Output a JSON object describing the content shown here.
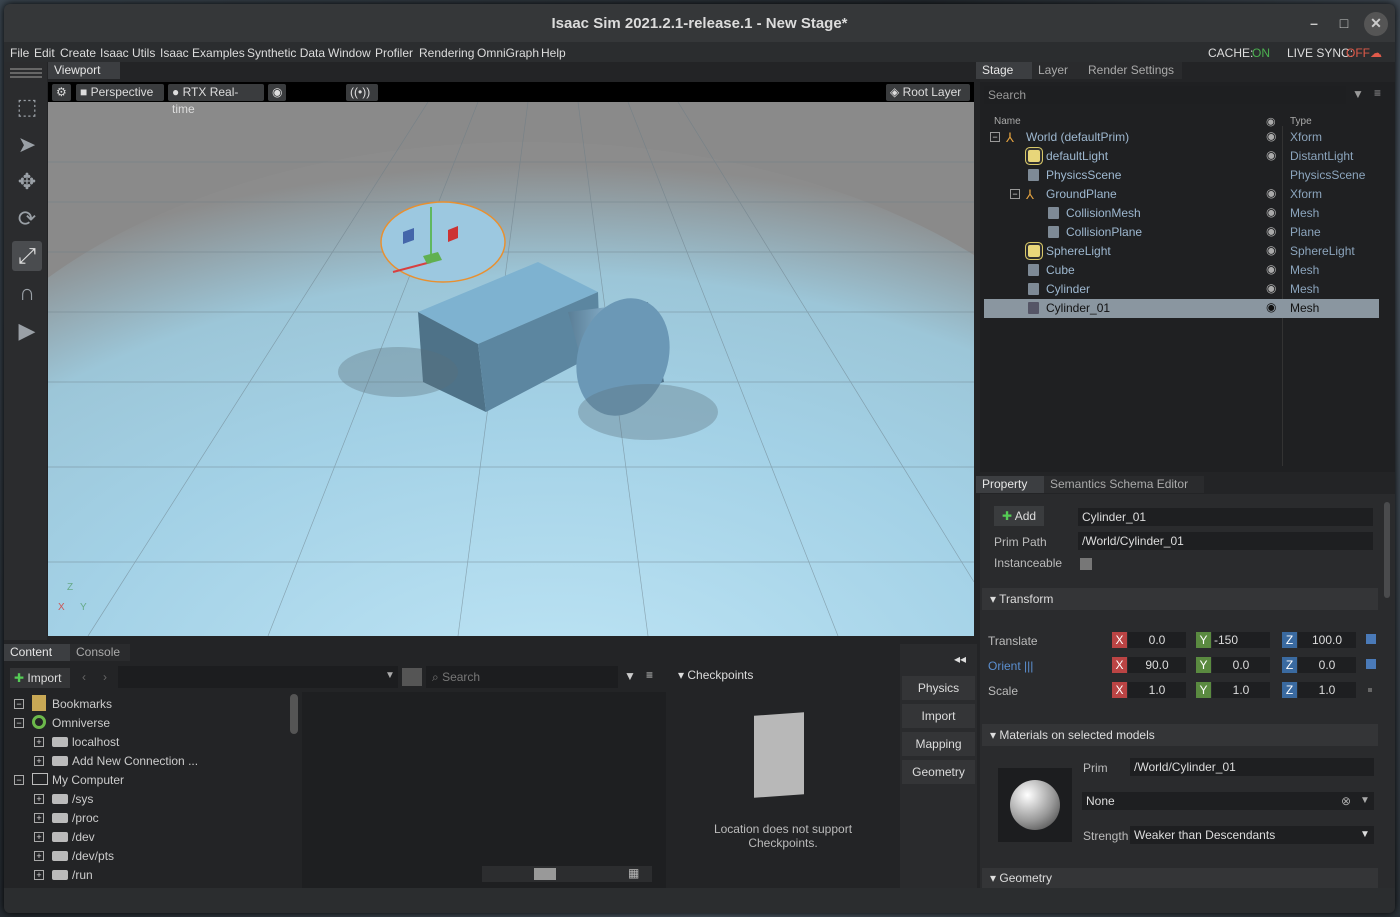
{
  "window": {
    "title": "Isaac Sim 2021.2.1-release.1 - New Stage*"
  },
  "menu": [
    "File",
    "Edit",
    "Create",
    "Isaac Utils",
    "Isaac Examples",
    "Synthetic Data",
    "Window",
    "Profiler",
    "Rendering",
    "OmniGraph",
    "Help"
  ],
  "sync": {
    "cache_label": "CACHE:",
    "cache_value": "ON",
    "live_label": "LIVE SYNC:",
    "live_value": "OFF"
  },
  "viewport": {
    "tab": "Viewport",
    "camera": "Perspective",
    "renderer": "RTX Real-time",
    "layer": "Root Layer",
    "axes": {
      "z": "Z",
      "x": "X",
      "y": "Y"
    }
  },
  "stage": {
    "tabs": [
      "Stage",
      "Layer",
      "Render Settings"
    ],
    "search_placeholder": "Search",
    "col_name": "Name",
    "col_type": "Type",
    "rows": [
      {
        "name": "World (defaultPrim)",
        "type": "Xform"
      },
      {
        "name": "defaultLight",
        "type": "DistantLight"
      },
      {
        "name": "PhysicsScene",
        "type": "PhysicsScene"
      },
      {
        "name": "GroundPlane",
        "type": "Xform"
      },
      {
        "name": "CollisionMesh",
        "type": "Mesh"
      },
      {
        "name": "CollisionPlane",
        "type": "Plane"
      },
      {
        "name": "SphereLight",
        "type": "SphereLight"
      },
      {
        "name": "Cube",
        "type": "Mesh"
      },
      {
        "name": "Cylinder",
        "type": "Mesh"
      },
      {
        "name": "Cylinder_01",
        "type": "Mesh"
      }
    ]
  },
  "property": {
    "tabs": [
      "Property",
      "Semantics Schema Editor"
    ],
    "add_label": "Add",
    "prim_name": "Cylinder_01",
    "prim_path_label": "Prim Path",
    "prim_path": "/World/Cylinder_01",
    "instanceable_label": "Instanceable",
    "transform_label": "Transform",
    "translate_label": "Translate",
    "orient_label": "Orient",
    "scale_label": "Scale",
    "translate": [
      "0.0",
      "-150",
      "100.0"
    ],
    "orient": [
      "90.0",
      "0.0",
      "0.0"
    ],
    "scale": [
      "1.0",
      "1.0",
      "1.0"
    ],
    "axis_x": "X",
    "axis_y": "Y",
    "axis_z": "Z",
    "materials_label": "Materials on selected models",
    "prim_label": "Prim",
    "material_prim": "/World/Cylinder_01",
    "material": "None",
    "strength_label": "Strength",
    "strength": "Weaker than Descendants",
    "geometry_label": "Geometry"
  },
  "content": {
    "tabs": [
      "Content",
      "Console"
    ],
    "import_label": "Import",
    "search_placeholder": "Search",
    "tree": [
      "Bookmarks",
      "Omniverse",
      "localhost",
      "Add New Connection ...",
      "My Computer",
      "/sys",
      "/proc",
      "/dev",
      "/dev/pts",
      "/run"
    ],
    "checkpoints_label": "Checkpoints",
    "checkpoints_msg_line1": "Location does not support",
    "checkpoints_msg_line2": "Checkpoints."
  },
  "side_buttons": [
    "Physics",
    "Import",
    "Mapping",
    "Geometry"
  ],
  "colors": {
    "accent_on": "#4caf50",
    "accent_off": "#e05a4a",
    "selection": "#8a96a0"
  }
}
